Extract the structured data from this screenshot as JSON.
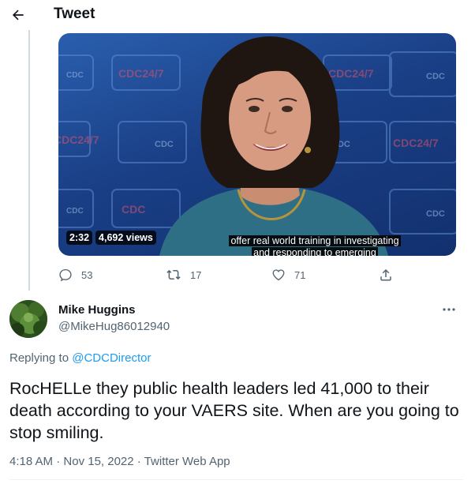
{
  "header": {
    "title": "Tweet",
    "back_icon": "arrow-left-icon"
  },
  "video": {
    "caption_line1": "offer real world training in investigating",
    "caption_line2": "and responding to emerging",
    "duration": "2:32",
    "views": "4,692 views",
    "backdrop_logo_texts": [
      "CDC",
      "CDC24/7"
    ]
  },
  "actions": {
    "reply": {
      "icon": "reply-icon",
      "count": "53"
    },
    "retweet": {
      "icon": "retweet-icon",
      "count": "17"
    },
    "like": {
      "icon": "heart-icon",
      "count": "71"
    },
    "share": {
      "icon": "share-icon"
    }
  },
  "reply_tweet": {
    "author_name": "Mike Huggins",
    "author_handle": "@MikeHug86012940",
    "replying_prefix": "Replying to",
    "replying_to": "@CDCDirector",
    "text": "RocHELLe they public health leaders led 41,000 to their death according to your VAERS site. When are you going to stop smiling.",
    "time": "4:18 AM",
    "separator": "·",
    "date": "Nov 15, 2022",
    "source": "Twitter Web App",
    "more_icon": "more-dots-icon"
  },
  "colors": {
    "text_primary": "#0f1419",
    "text_secondary": "#536471",
    "link": "#1d9bf0",
    "thread_line": "#cfd9de",
    "video_bg": "#1e4a96",
    "blouse": "#2f6f86"
  }
}
